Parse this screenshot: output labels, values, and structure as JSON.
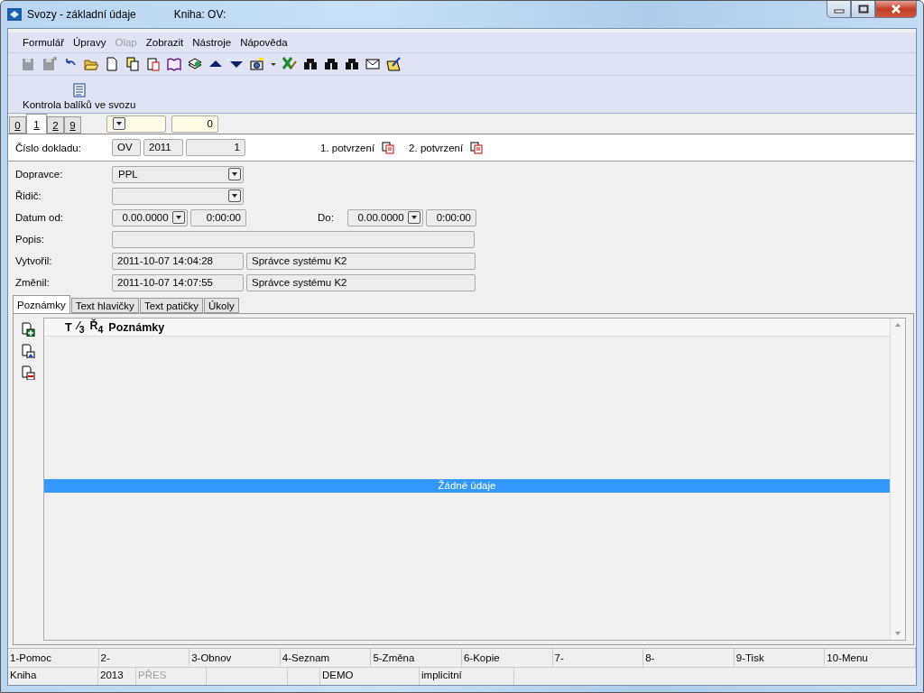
{
  "window": {
    "title": "Svozy - základní údaje",
    "book": "Kniha: OV:"
  },
  "menu": [
    {
      "label": "Formulář",
      "disabled": false
    },
    {
      "label": "Úpravy",
      "disabled": false
    },
    {
      "label": "Olap",
      "disabled": true
    },
    {
      "label": "Zobrazit",
      "disabled": false
    },
    {
      "label": "Nástroje",
      "disabled": false
    },
    {
      "label": "Nápověda",
      "disabled": false
    }
  ],
  "toolbar": [
    {
      "kind": "save",
      "disabled": true
    },
    {
      "kind": "saveas",
      "disabled": true
    },
    {
      "kind": "undo",
      "disabled": false
    },
    {
      "kind": "open",
      "disabled": false
    },
    {
      "kind": "new",
      "disabled": false
    },
    {
      "kind": "copy",
      "disabled": false
    },
    {
      "kind": "paste",
      "disabled": false
    },
    {
      "kind": "book",
      "disabled": false
    },
    {
      "kind": "stack",
      "disabled": false
    },
    {
      "kind": "up",
      "disabled": false
    },
    {
      "kind": "down",
      "disabled": false
    },
    {
      "kind": "camera",
      "disabled": false
    },
    {
      "kind": "caret",
      "disabled": false
    },
    {
      "kind": "sheet",
      "disabled": false
    },
    {
      "kind": "find",
      "disabled": false
    },
    {
      "kind": "find",
      "disabled": false
    },
    {
      "kind": "find",
      "disabled": false
    },
    {
      "kind": "mail",
      "disabled": false
    },
    {
      "kind": "notepad",
      "disabled": false
    }
  ],
  "action_button": {
    "label": "Kontrola balíků ve svozu"
  },
  "page_tabs": [
    {
      "label": "0",
      "selected": false
    },
    {
      "label": "1",
      "selected": true
    },
    {
      "label": "2",
      "selected": false
    },
    {
      "label": "9",
      "selected": false
    }
  ],
  "filter": {
    "value": "0"
  },
  "header": {
    "label": "Číslo dokladu:",
    "book": "OV",
    "year": "2011",
    "number": "1",
    "confirmations": [
      "1. potvrzení",
      "2. potvrzení"
    ]
  },
  "form": {
    "carrier": {
      "label": "Dopravce:",
      "value": "PPL"
    },
    "driver": {
      "label": "Řidič:"
    },
    "date_from": {
      "label": "Datum od:",
      "date": "0.00.0000",
      "time": "0:00:00"
    },
    "date_to": {
      "label": "Do:",
      "date": "0.00.0000",
      "time": "0:00:00"
    },
    "description": {
      "label": "Popis:"
    },
    "created": {
      "label": "Vytvořil:",
      "timestamp": "2011-10-07 14:04:28",
      "user": "Správce systému K2"
    },
    "changed": {
      "label": "Změnil:",
      "timestamp": "2011-10-07 14:07:55",
      "user": "Správce systému K2"
    }
  },
  "detail_tabs": [
    {
      "label": "Poznámky",
      "selected": true
    },
    {
      "label": "Text hlavičky",
      "selected": false
    },
    {
      "label": "Text patičky",
      "selected": false
    },
    {
      "label": "Úkoly",
      "selected": false
    }
  ],
  "notes_table": {
    "columns": [
      "T",
      "⁄$_{3}$",
      "Ř$_{4}$",
      "Poznámky"
    ],
    "empty_message": "Žádné údaje"
  },
  "function_keys": [
    "1-Pomoc",
    "2-",
    "3-Obnov",
    "4-Seznam",
    "5-Změna",
    "6-Kopie",
    "7-",
    "8-",
    "9-Tisk",
    "10-Menu"
  ],
  "status_bar": [
    {
      "text": "Kniha",
      "disabled": false
    },
    {
      "text": "2013",
      "disabled": false
    },
    {
      "text": "PŘES",
      "disabled": true
    },
    {
      "text": "DEMO",
      "disabled": false
    },
    {
      "text": "implicitní",
      "disabled": false
    }
  ]
}
